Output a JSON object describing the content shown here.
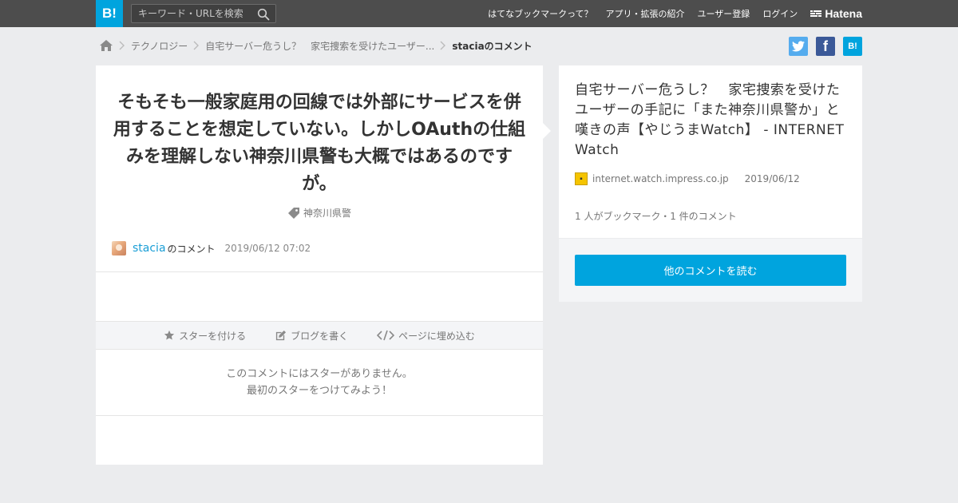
{
  "topbar": {
    "logo_label": "B!",
    "search_placeholder": "キーワード・URLを検索",
    "nav": [
      "はてなブックマークって？",
      "アプリ・拡張の紹介",
      "ユーザー登録",
      "ログイン"
    ],
    "brand": "Hatena"
  },
  "breadcrumb": {
    "items": [
      "テクノロジー",
      "自宅サーバー危うし？　家宅捜索を受けたユーザー...",
      "staciaのコメント"
    ]
  },
  "share": {
    "hatena_label": "B!",
    "facebook_label": "f"
  },
  "comment": {
    "text": "そもそも一般家庭用の回線では外部にサービスを併用することを想定していない。しかしOAuthの仕組みを理解しない神奈川県警も大概ではあるのですが。",
    "tag": "神奈川県警",
    "username": "stacia",
    "suffix": "のコメント",
    "timestamp": "2019/06/12 07:02"
  },
  "actions": {
    "star": "スターを付ける",
    "blog": "ブログを書く",
    "embed": "ページに埋め込む"
  },
  "stars": {
    "line1": "このコメントにはスターがありません。",
    "line2": "最初のスターをつけてみよう！"
  },
  "entry": {
    "title": "自宅サーバー危うし？　家宅捜索を受けたユーザーの手記に「また神奈川県警か」と嘆きの声【やじうまWatch】 - INTERNET Watch",
    "domain": "internet.watch.impress.co.jp",
    "date": "2019/06/12",
    "counts": "1 人がブックマーク・1 件のコメント",
    "read_more": "他のコメントを読む"
  },
  "colors": {
    "accent": "#00a4de",
    "topbar": "#4d4d4d",
    "twitter": "#55acee",
    "facebook": "#3b5998"
  }
}
